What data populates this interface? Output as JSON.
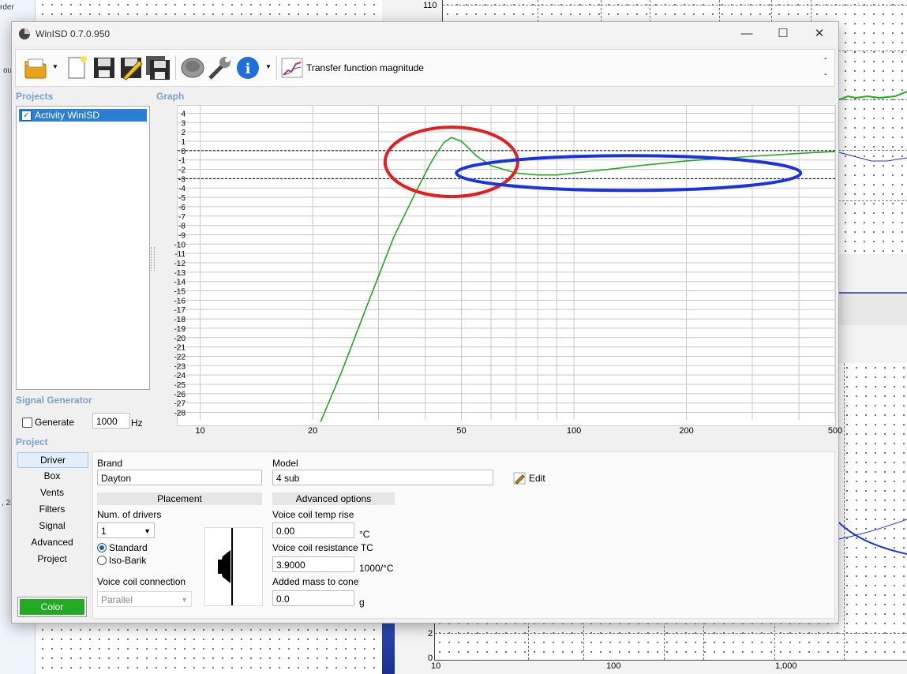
{
  "background": {
    "left_window": {
      "fragments": [
        "rder",
        "ou",
        ", 2r"
      ]
    },
    "right_window": {
      "top_chart": {
        "y_tick": "110"
      },
      "bottom_chart": {
        "y_ticks": [
          "2",
          "0"
        ],
        "x_ticks": [
          "10",
          "100",
          "1,000"
        ]
      }
    }
  },
  "window": {
    "title": "WinISD 0.7.0.950",
    "controls": {
      "minimize": "—",
      "maximize": "☐",
      "close": "✕"
    }
  },
  "toolbar": {
    "buttons": [
      {
        "icon": "open-folder-icon"
      },
      {
        "icon": "new-project-icon"
      },
      {
        "icon": "save-icon"
      },
      {
        "icon": "save-edit-icon"
      },
      {
        "icon": "save-all-icon"
      },
      {
        "icon": "driver-icon"
      },
      {
        "icon": "wrench-icon"
      },
      {
        "icon": "info-icon"
      }
    ],
    "view_label": "Transfer function magnitude",
    "right_marks": [
      "-",
      "-"
    ]
  },
  "sections": {
    "projects": "Projects",
    "graph": "Graph",
    "signal_generator": "Signal Generator",
    "project": "Project"
  },
  "projects": {
    "items": [
      {
        "label": "Activity WinISD",
        "checked": true
      }
    ]
  },
  "signal_generator": {
    "generate_label": "Generate",
    "frequency": "1000",
    "unit": "Hz"
  },
  "nav": {
    "items": [
      "Driver",
      "Box",
      "Vents",
      "Filters",
      "Signal",
      "Advanced",
      "Project"
    ],
    "selected": "Driver",
    "color_button": "Color",
    "color_value": "#22aa22"
  },
  "driver": {
    "brand_label": "Brand",
    "brand": "Dayton",
    "model_label": "Model",
    "model": "4 sub",
    "edit_label": "Edit",
    "placement_header": "Placement",
    "num_drivers_label": "Num. of drivers",
    "num_drivers": "1",
    "placement_options": [
      "Standard",
      "Iso-Barik"
    ],
    "placement_selected": "Standard",
    "voice_coil_connection_label": "Voice coil connection",
    "voice_coil_connection": "Parallel",
    "advanced_header": "Advanced options",
    "vc_temp_label": "Voice coil temp rise",
    "vc_temp": "0.00",
    "vc_temp_unit": "°C",
    "vc_res_label": "Voice coil resistance TC",
    "vc_res": "3.9000",
    "vc_res_unit": "1000/°C",
    "mass_label": "Added mass to cone",
    "mass": "0.0",
    "mass_unit": "g"
  },
  "chart_data": {
    "type": "line",
    "title": "",
    "xlabel": "",
    "ylabel": "",
    "x_scale": "log",
    "xlim": [
      8.7,
      500
    ],
    "ylim": [
      -28.8,
      4.8
    ],
    "x_tick_labels": [
      "10",
      "20",
      "50",
      "100",
      "200",
      "500"
    ],
    "y_tick_labels": [
      "4",
      "3",
      "2",
      "1",
      "0",
      "-1",
      "-2",
      "-3",
      "-4",
      "-5",
      "-6",
      "-7",
      "-8",
      "-9",
      "-10",
      "-11",
      "-12",
      "-13",
      "-14",
      "-15",
      "-16",
      "-17",
      "-18",
      "-19",
      "-20",
      "-21",
      "-22",
      "-23",
      "-24",
      "-25",
      "-26",
      "-27",
      "-28"
    ],
    "reference_lines": [
      0,
      -3
    ],
    "grid": true,
    "series": [
      {
        "color": "#22aa22",
        "x": [
          21,
          24,
          28,
          33,
          38,
          41,
          43,
          45,
          47,
          50,
          55,
          60,
          70,
          80,
          90,
          100,
          130,
          150,
          200,
          300,
          400,
          500
        ],
        "y": [
          -29,
          -23.5,
          -16.5,
          -9.2,
          -4.2,
          -1.6,
          -0.2,
          0.9,
          1.4,
          1.0,
          -0.6,
          -1.6,
          -2.4,
          -2.6,
          -2.6,
          -2.4,
          -1.9,
          -1.6,
          -1.1,
          -0.6,
          -0.3,
          -0.1
        ]
      }
    ],
    "annotations": [
      {
        "shape": "ellipse",
        "color": "#e02020",
        "center_x": 47,
        "center_y": -1.2
      },
      {
        "shape": "ellipse",
        "color": "#1a33e0",
        "center_x": 140,
        "center_y": -2.4
      }
    ]
  }
}
